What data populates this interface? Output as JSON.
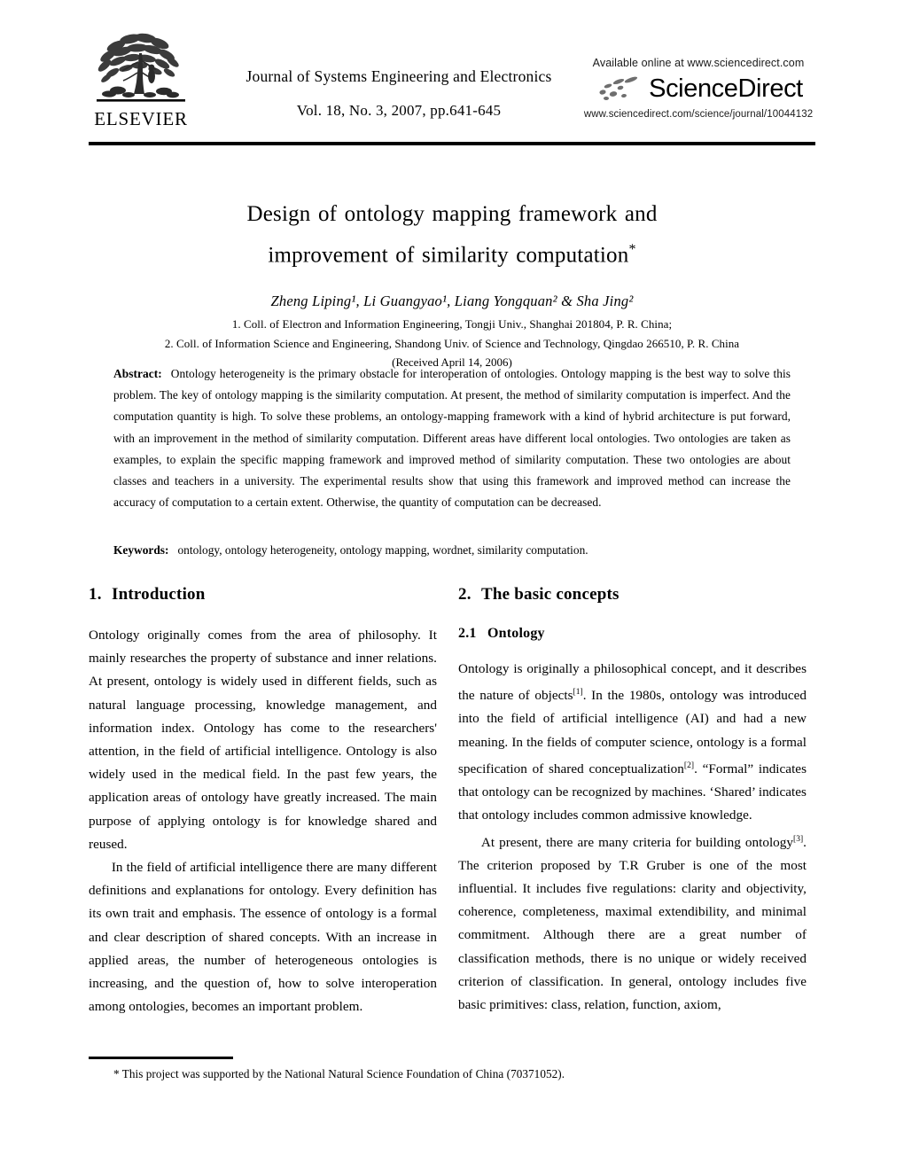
{
  "masthead": {
    "publisher": "ELSEVIER",
    "journal_title": "Journal of Systems Engineering and Electronics",
    "volume_line": "Vol. 18, No. 3, 2007, pp.641-645",
    "sciencedirect": {
      "available_line": "Available online at www.sciencedirect.com",
      "wordmark": "ScienceDirect",
      "url_line": "www.sciencedirect.com/science/journal/10044132"
    }
  },
  "article": {
    "title_line1": "Design of ontology mapping framework and",
    "title_line2": "improvement of similarity computation",
    "title_star": "*",
    "authors": "Zheng Liping¹, Li Guangyao¹, Liang Yongquan² & Sha Jing²",
    "affiliation_1": "1. Coll. of Electron and Information Engineering, Tongji Univ., Shanghai 201804, P. R. China;",
    "affiliation_2": "2. Coll. of Information Science and Engineering, Shandong Univ. of Science and Technology, Qingdao 266510, P. R. China",
    "received": "(Received April 14, 2006)"
  },
  "abstract": {
    "label": "Abstract:",
    "text": "Ontology heterogeneity is the primary obstacle for interoperation of ontologies. Ontology mapping is the best way to solve this problem. The key of ontology mapping is the similarity computation. At present, the method of similarity computation is imperfect. And the computation quantity is high. To solve these problems, an ontology-mapping framework with a kind of hybrid architecture is put forward, with an improvement in the method of similarity computation. Different areas have different local ontologies. Two ontologies are taken as examples, to explain the specific mapping framework and improved method of similarity computation. These two ontologies are about classes and teachers in a university. The experimental results show that using this framework and improved method can increase the accuracy of computation to a certain extent. Otherwise, the quantity of computation can be decreased."
  },
  "keywords": {
    "label": "Keywords:",
    "text": "ontology, ontology heterogeneity, ontology mapping, wordnet, similarity computation."
  },
  "sections": {
    "intro": {
      "number": "1.",
      "heading": "Introduction",
      "para1": "Ontology originally comes from the area of philosophy. It mainly researches the property of substance and inner relations. At present, ontology is widely used in different fields, such as natural language processing, knowledge management, and information index. Ontology has come to the researchers' attention, in the field of artificial intelligence. Ontology is also widely used in the medical field. In the past few years, the application areas of ontology have greatly increased. The main purpose of applying ontology is for knowledge shared and reused.",
      "para2": "In the field of artificial intelligence there are many different definitions and explanations for ontology. Every definition has its own trait and emphasis. The essence of ontology is a formal and clear description of shared concepts. With an increase in applied areas, the number of heterogeneous ontologies is increasing, and the question of, how to solve interoperation among ontologies, becomes an important problem."
    },
    "basic_concepts": {
      "number": "2.",
      "heading": "The basic concepts",
      "sub_number": "2.1",
      "sub_heading": "Ontology",
      "para1_a": "Ontology is originally a philosophical concept, and it describes the nature of objects",
      "para1_ref1": "[1]",
      "para1_b": ". In the 1980s, ontology was introduced into the field of artificial intelligence (AI) and had a new meaning. In the fields of computer science, ontology is a formal specification of shared conceptualization",
      "para1_ref2": "[2]",
      "para1_c": ". “Formal” indicates that ontology can be recognized by machines. ‘Shared’ indicates that ontology includes common admissive knowledge.",
      "para2_a": "At present, there are many criteria for building ontology",
      "para2_ref3": "[3]",
      "para2_b": ". The criterion proposed by T.R Gruber is one of the most influential. It includes five regulations: clarity and objectivity, coherence, completeness, maximal extendibility, and minimal commitment. Although there are a great number of classification methods, there is no unique or widely received criterion of classification. In general, ontology includes five basic primitives: class, relation, function, axiom,"
    }
  },
  "footnote": {
    "text": "* This project was supported by the National Natural Science Foundation of China (70371052)."
  },
  "colors": {
    "ink": "#000000",
    "paper": "#ffffff"
  }
}
